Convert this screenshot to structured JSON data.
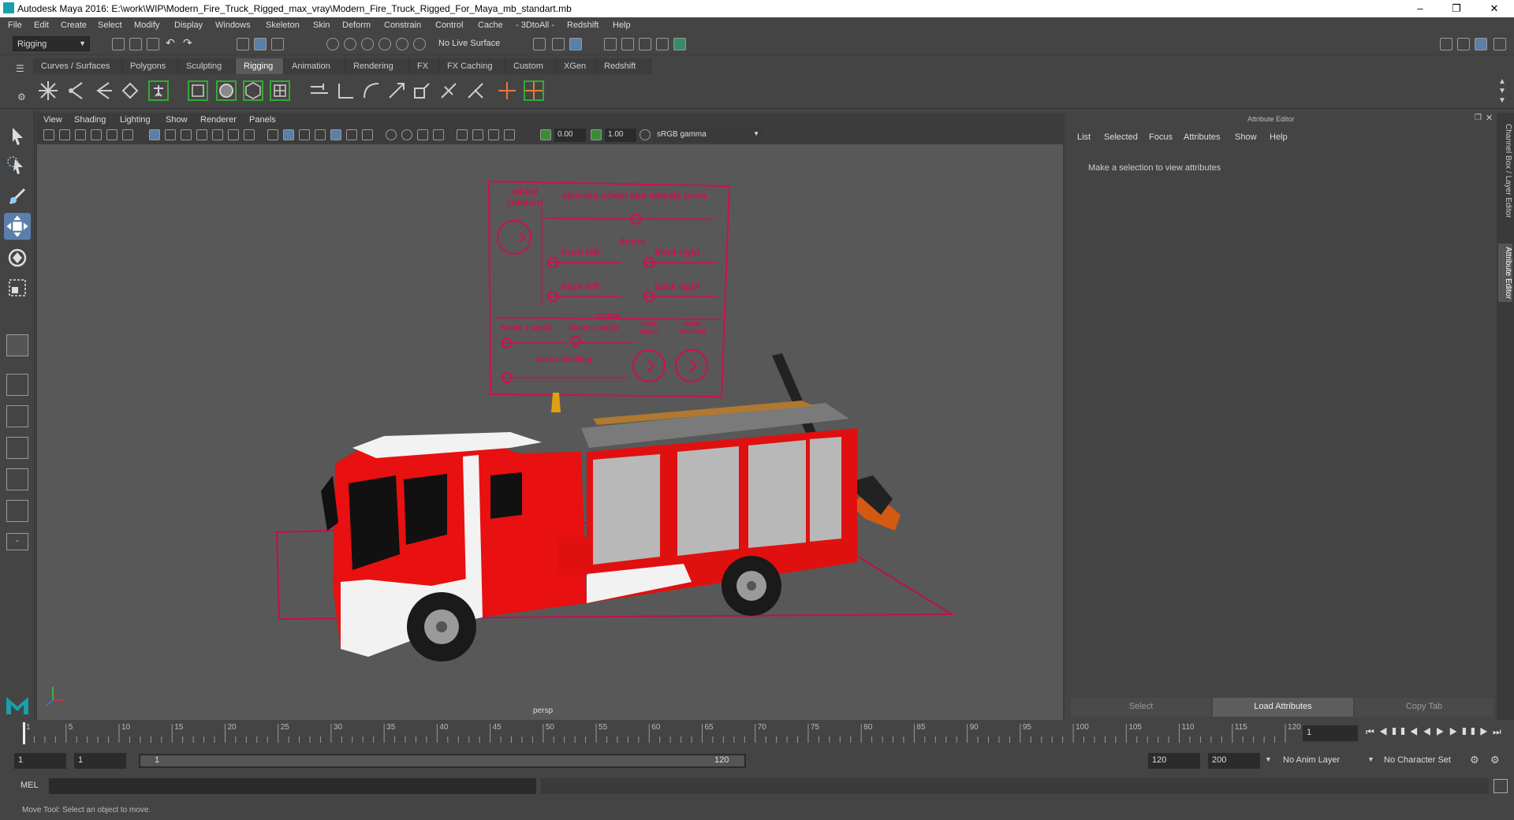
{
  "window": {
    "title": "Autodesk Maya 2016: E:\\work\\WIP\\Modern_Fire_Truck_Rigged_max_vray\\Modern_Fire_Truck_Rigged_For_Maya_mb_standart.mb"
  },
  "menus": [
    "File",
    "Edit",
    "Create",
    "Select",
    "Modify",
    "Display",
    "Windows",
    "Skeleton",
    "Skin",
    "Deform",
    "Constrain",
    "Control",
    "Cache",
    "- 3DtoAll -",
    "Redshift",
    "Help"
  ],
  "toolbar": {
    "mode": "Rigging",
    "live_surface": "No Live Surface"
  },
  "shelf_tabs": [
    "Curves / Surfaces",
    "Polygons",
    "Sculpting",
    "Rigging",
    "Animation",
    "Rendering",
    "FX",
    "FX Caching",
    "Custom",
    "XGen",
    "Redshift"
  ],
  "shelf_active": "Rigging",
  "viewport": {
    "menus": [
      "View",
      "Shading",
      "Lighting",
      "Show",
      "Renderer",
      "Panels"
    ],
    "exposure": "0.00",
    "gamma": "1.00",
    "color_space": "sRGB gamma",
    "camera_label": "persp"
  },
  "rig_panel": {
    "wheel_rotation": "wheel rotation",
    "steering": "steering wheel and wheels turns",
    "doors": "doors",
    "front_left": "front left",
    "front_right": "front right",
    "back_left": "back left",
    "back_right": "back right",
    "crane": "crane",
    "boom1": "boom 1 angle",
    "boom2": "boom 2 angle",
    "hook_angle": "hook angle",
    "crane_rotation": "crane rotation",
    "stick": "stick unfolding"
  },
  "attribute_editor": {
    "title": "Attribute Editor",
    "menus": [
      "List",
      "Selected",
      "Focus",
      "Attributes",
      "Show",
      "Help"
    ],
    "message": "Make a selection to view attributes",
    "buttons": {
      "select": "Select",
      "load": "Load Attributes",
      "copy": "Copy Tab"
    }
  },
  "side_tabs": {
    "channel_box": "Channel Box / Layer Editor",
    "attribute_editor": "Attribute Editor"
  },
  "timeline": {
    "ticks": [
      "1",
      "5",
      "10",
      "15",
      "20",
      "25",
      "30",
      "35",
      "40",
      "45",
      "50",
      "55",
      "60",
      "65",
      "70",
      "75",
      "80",
      "85",
      "90",
      "95",
      "100",
      "105",
      "110",
      "115",
      "120"
    ],
    "current_frame": "1"
  },
  "range": {
    "start": "1",
    "playback_start": "1",
    "slider_start": "1",
    "slider_end": "120",
    "playback_end": "120",
    "end": "200",
    "anim_layer": "No Anim Layer",
    "character_set": "No Character Set"
  },
  "cmdline": {
    "label": "MEL"
  },
  "help": {
    "text": "Move Tool: Select an object to move."
  }
}
